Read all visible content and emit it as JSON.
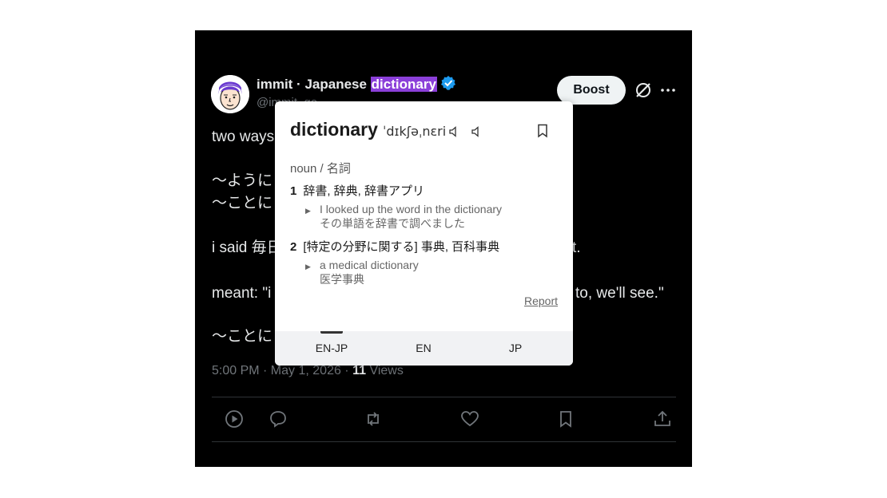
{
  "tweet": {
    "author_name": "immit · Japanese ",
    "author_name_highlight": "dictionary",
    "handle": "@immit_go",
    "boost_label": "Boost",
    "body_lines": [
      "two ways",
      "〜ように",
      "〜ことに",
      "i said 毎日",
      "meant: \"i",
      "〜ことに"
    ],
    "body_line_right_1": "t.",
    "body_line_right_2": "to, we'll see.\"",
    "timestamp": "5:00 PM · May 1, 2026 · ",
    "views_count": "11",
    "views_label": " Views",
    "colors": {
      "background": "#000000",
      "text": "#e7e9ea",
      "muted": "#71767b",
      "highlight": "#8b3fd9",
      "verified": "#1d9bf0"
    }
  },
  "popup": {
    "word": "dictionary",
    "ipa": "ˈdɪkʃəˌnɛri",
    "part_of_speech": "noun / 名詞",
    "senses": [
      {
        "num": "1",
        "text": "辞書, 辞典, 辞書アプリ",
        "example_en": "I looked up the word in the dictionary",
        "example_jp": "その単語を辞書で調べました"
      },
      {
        "num": "2",
        "text": "[特定の分野に関する] 事典, 百科事典",
        "example_en": "a medical dictionary",
        "example_jp": "医学事典"
      }
    ],
    "report_label": "Report",
    "tabs": [
      "EN-JP",
      "EN",
      "JP"
    ],
    "active_tab": "EN-JP",
    "icons": [
      "speaker-icon",
      "speaker-icon",
      "bookmark-icon"
    ]
  },
  "actions": [
    "play-icon",
    "reply-icon",
    "retweet-icon",
    "like-icon",
    "bookmark-icon",
    "share-icon"
  ]
}
